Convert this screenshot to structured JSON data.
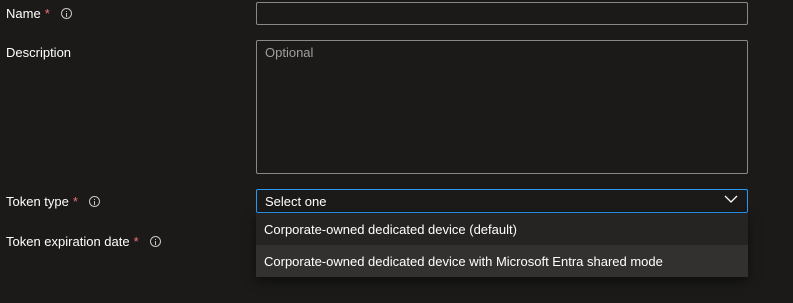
{
  "form": {
    "name": {
      "label": "Name",
      "required_mark": "*",
      "value": ""
    },
    "description": {
      "label": "Description",
      "placeholder": "Optional",
      "value": ""
    },
    "token_type": {
      "label": "Token type",
      "required_mark": "*",
      "selected": "Select one",
      "options": [
        "Corporate-owned dedicated device (default)",
        "Corporate-owned dedicated device with Microsoft Entra shared mode"
      ]
    },
    "token_expiration": {
      "label": "Token expiration date",
      "required_mark": "*"
    }
  },
  "colors": {
    "background": "#1b1a19",
    "required": "#f1707b",
    "focus_border": "#2899f5",
    "input_border": "#8a8886"
  },
  "icons": [
    "info-icon",
    "chevron-down-icon"
  ]
}
